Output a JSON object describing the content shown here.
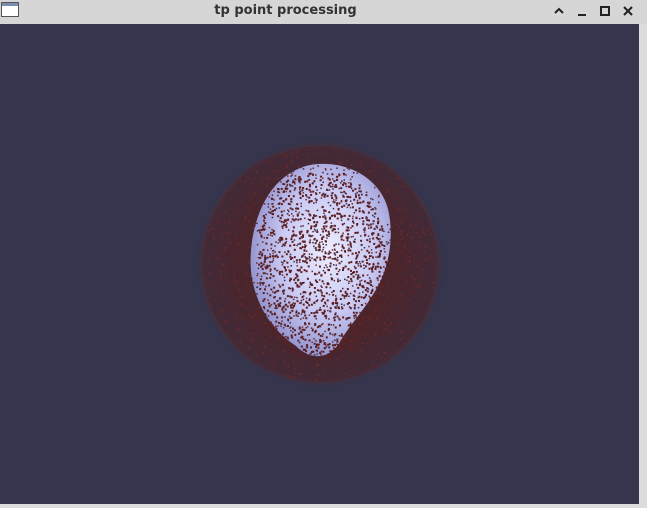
{
  "window": {
    "title": "tp point processing",
    "icons": [
      "app-window-icon",
      "chevron-up-icon",
      "minimize-icon",
      "maximize-icon",
      "close-icon"
    ]
  },
  "scene": {
    "background_color": "#35354d",
    "point_cloud_color": "#5a1f22",
    "mesh_color": "#c8c8f2",
    "description_icons": [
      "point-cloud",
      "mesh-blob"
    ]
  }
}
